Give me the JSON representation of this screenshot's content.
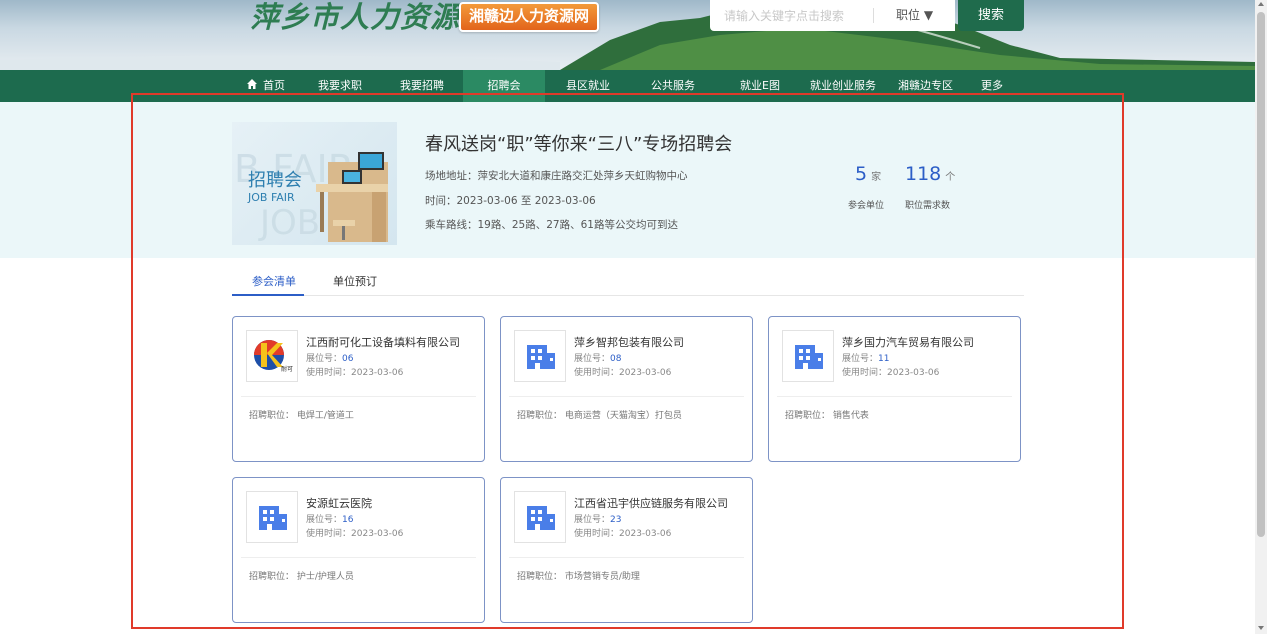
{
  "header": {
    "logo_main": "萍乡市人力资源网",
    "logo_sub": "湘赣边人力资源网",
    "search_placeholder": "请输入关键字点击搜索",
    "search_type": "职位 ▼",
    "search_button": "搜索"
  },
  "nav": {
    "items": [
      "首页",
      "我要求职",
      "我要招聘",
      "招聘会",
      "县区就业",
      "公共服务",
      "就业E图",
      "就业创业服务",
      "湘赣边专区",
      "更多"
    ],
    "active_index": 3
  },
  "fair": {
    "image_text_cn": "招聘会",
    "image_text_en": "JOB FAIR",
    "title": "春风送岗“职”等你来“三八”专场招聘会",
    "address": "场地地址：萍安北大道和康庄路交汇处萍乡天虹购物中心",
    "time": "时间：2023-03-06 至 2023-03-06",
    "route": "乘车路线：19路、25路、27路、61路等公交均可到达",
    "stats": [
      {
        "value": "5",
        "unit": "家",
        "label": "参会单位"
      },
      {
        "value": "118",
        "unit": "个",
        "label": "职位需求数"
      }
    ]
  },
  "tabs": [
    "参会清单",
    "单位预订"
  ],
  "companies": [
    {
      "name": "江西耐可化工设备填料有限公司",
      "booth_label": "展位号：",
      "booth": "06",
      "time_label": "使用时间：",
      "time": "2023-03-06",
      "jobs": "招聘职位：  电焊工/管道工",
      "logo": "naike-logo",
      "logo_text": "耐可"
    },
    {
      "name": "萍乡智邦包装有限公司",
      "booth_label": "展位号：",
      "booth": "08",
      "time_label": "使用时间：",
      "time": "2023-03-06",
      "jobs": "招聘职位：  电商运营（天猫淘宝）打包员",
      "logo": "building-icon"
    },
    {
      "name": "萍乡国力汽车贸易有限公司",
      "booth_label": "展位号：",
      "booth": "11",
      "time_label": "使用时间：",
      "time": "2023-03-06",
      "jobs": "招聘职位：  销售代表",
      "logo": "building-icon"
    },
    {
      "name": "安源虹云医院",
      "booth_label": "展位号：",
      "booth": "16",
      "time_label": "使用时间：",
      "time": "2023-03-06",
      "jobs": "招聘职位：  护士/护理人员",
      "logo": "building-icon"
    },
    {
      "name": "江西省迅宇供应链服务有限公司",
      "booth_label": "展位号：",
      "booth": "23",
      "time_label": "使用时间：",
      "time": "2023-03-06",
      "jobs": "招聘职位：  市场营销专员/助理",
      "logo": "building-icon"
    }
  ],
  "colors": {
    "nav_green": "#1d6b4e",
    "accent_blue": "#2c5ec7",
    "highlight_red": "#e03a2a",
    "band_bg": "#ebf7f9"
  }
}
